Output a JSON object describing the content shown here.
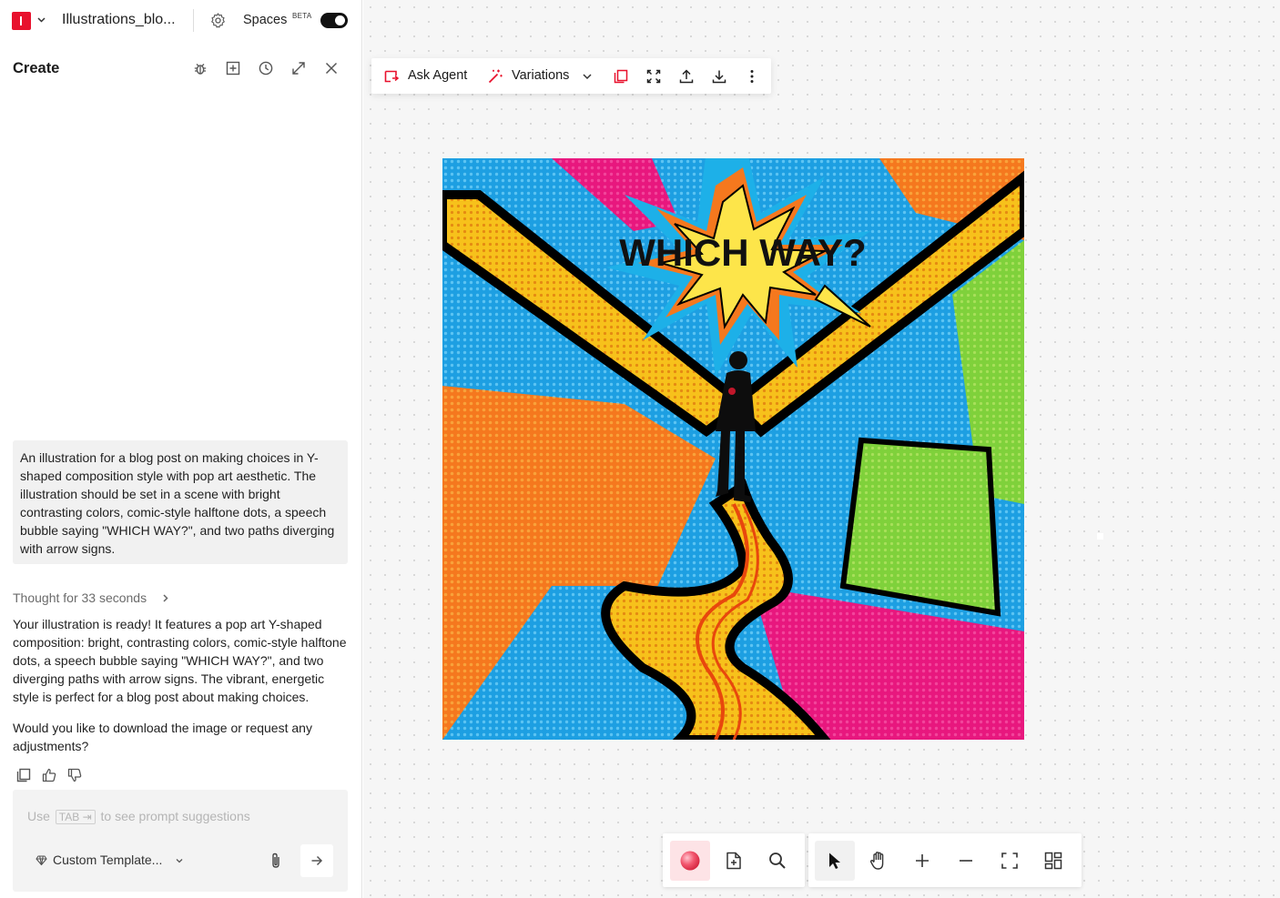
{
  "header": {
    "file_title": "Illustrations_blo...",
    "spaces_label": "Spaces",
    "beta_badge": "BETA",
    "spaces_enabled": true
  },
  "panel": {
    "title": "Create",
    "icons": [
      "bug-icon",
      "add-frame-icon",
      "history-icon",
      "expand-icon",
      "close-icon"
    ]
  },
  "chat": {
    "user_prompt": "An illustration for a blog post on making choices in Y-shaped composition style with pop art aesthetic. The illustration should be set in a scene with bright contrasting colors, comic-style halftone dots, a speech bubble saying \"WHICH WAY?\", and two paths diverging with arrow signs.",
    "thought_label": "Thought for 33 seconds",
    "response_1": "Your illustration is ready! It features a pop art Y-shaped composition: bright, contrasting colors, comic-style halftone dots, a speech bubble saying \"WHICH WAY?\", and two diverging paths with arrow signs. The vibrant, energetic style is perfect for a blog post about making choices.",
    "response_2": "Would you like to download the image or request any adjustments?"
  },
  "input": {
    "hint_prefix": "Use",
    "hint_key": "TAB ⇥",
    "hint_suffix": "to see prompt suggestions",
    "template_label": "Custom Template..."
  },
  "canvas_toolbar": {
    "ask_agent_label": "Ask Agent",
    "variations_label": "Variations"
  },
  "artwork": {
    "speech_text": "WHICH WAY?"
  },
  "colors": {
    "brand_red": "#e8112d",
    "accent_pink": "#fde3e6"
  }
}
